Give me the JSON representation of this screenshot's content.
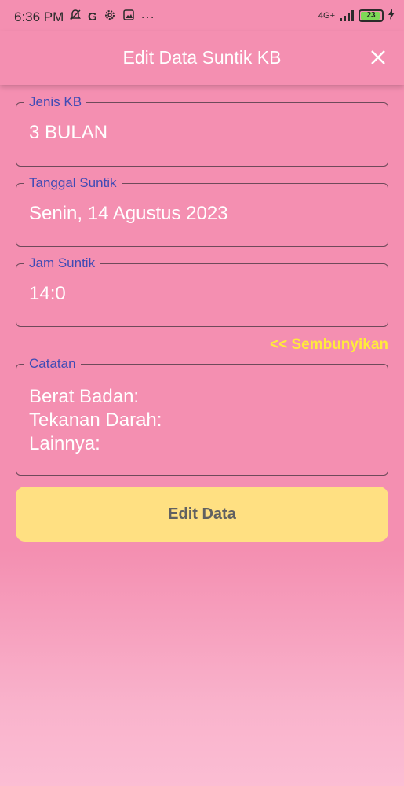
{
  "status_bar": {
    "time": "6:36 PM",
    "icons": [
      "bell-off-icon",
      "google-icon",
      "settings-icon",
      "gallery-icon",
      "more-dots-icon"
    ],
    "network_label": "4G+",
    "battery_level": "23"
  },
  "appbar": {
    "title": "Edit Data Suntik KB",
    "close_icon": "close-icon"
  },
  "form": {
    "jenis_kb": {
      "label": "Jenis KB",
      "value": "3 BULAN"
    },
    "tanggal_suntik": {
      "label": "Tanggal Suntik",
      "value": "Senin, 14 Agustus 2023"
    },
    "jam_suntik": {
      "label": "Jam Suntik",
      "value": "14:0"
    },
    "toggle_label": "<< Sembunyikan",
    "catatan": {
      "label": "Catatan",
      "lines": [
        "Berat Badan:",
        "Tekanan Darah:",
        "Lainnya:"
      ]
    },
    "submit_label": "Edit Data"
  },
  "colors": {
    "background": "#f48fb1",
    "label": "#3f4bb5",
    "toggle": "#ffeb3b",
    "button": "#ffe082"
  }
}
